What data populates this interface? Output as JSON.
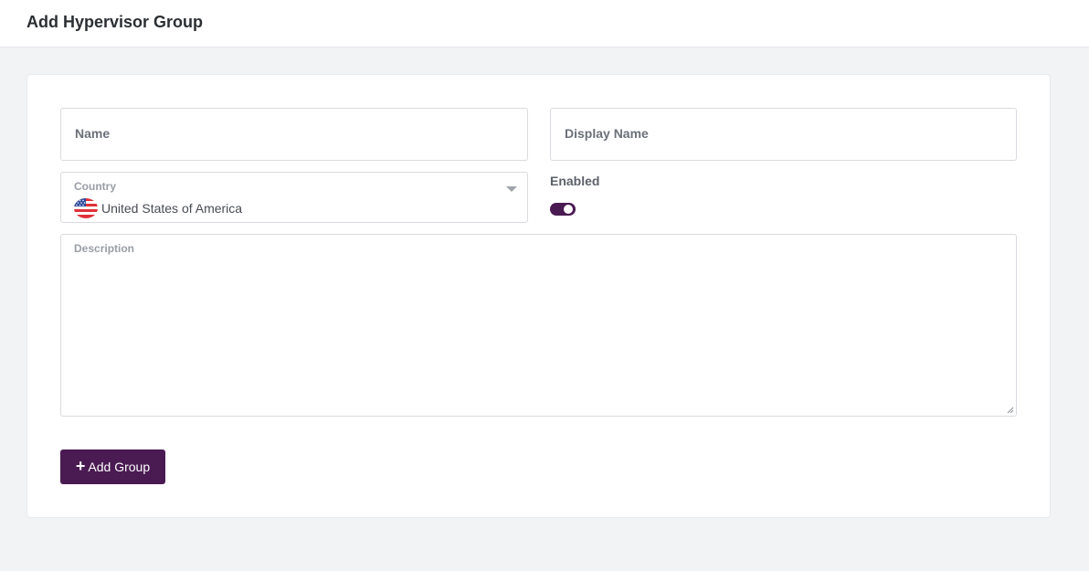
{
  "header": {
    "title": "Add Hypervisor Group"
  },
  "form": {
    "name_placeholder": "Name",
    "display_name_placeholder": "Display Name",
    "country": {
      "label": "Country",
      "value": "United States of America",
      "flag_icon": "us-flag-icon"
    },
    "enabled": {
      "label": "Enabled",
      "value": true
    },
    "description_placeholder": "Description",
    "submit": {
      "icon": "plus-icon",
      "label": "Add Group"
    }
  },
  "colors": {
    "accent": "#4a1a52",
    "background": "#f2f3f5",
    "card": "#ffffff",
    "border": "#d9dbe0"
  }
}
